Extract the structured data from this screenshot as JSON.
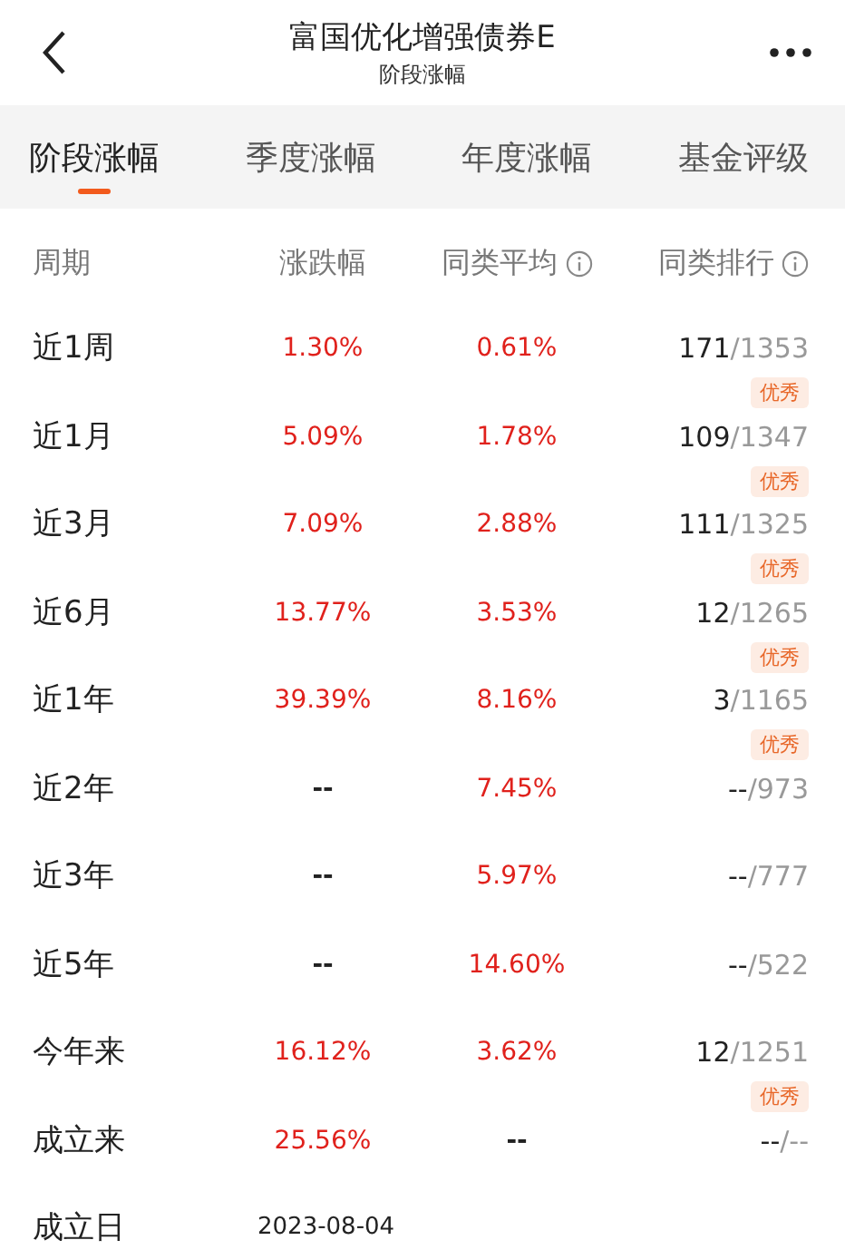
{
  "header": {
    "title": "富国优化增强债券E",
    "subtitle": "阶段涨幅"
  },
  "tabs": [
    {
      "label": "阶段涨幅",
      "selected": true
    },
    {
      "label": "季度涨幅",
      "selected": false
    },
    {
      "label": "年度涨幅",
      "selected": false
    },
    {
      "label": "基金评级",
      "selected": false
    }
  ],
  "table": {
    "columns": [
      {
        "label": "周期",
        "info": false
      },
      {
        "label": "涨跌幅",
        "info": false
      },
      {
        "label": "同类平均",
        "info": true
      },
      {
        "label": "同类排行",
        "info": true
      }
    ],
    "rows": [
      {
        "period": "近1周",
        "change": {
          "text": "1.30%",
          "rising": true
        },
        "average": {
          "text": "0.61%",
          "rising": true
        },
        "rank": "171",
        "total": "/1353",
        "badge": "优秀"
      },
      {
        "period": "近1月",
        "change": {
          "text": "5.09%",
          "rising": true
        },
        "average": {
          "text": "1.78%",
          "rising": true
        },
        "rank": "109",
        "total": "/1347",
        "badge": "优秀"
      },
      {
        "period": "近3月",
        "change": {
          "text": "7.09%",
          "rising": true
        },
        "average": {
          "text": "2.88%",
          "rising": true
        },
        "rank": "111",
        "total": "/1325",
        "badge": "优秀"
      },
      {
        "period": "近6月",
        "change": {
          "text": "13.77%",
          "rising": true
        },
        "average": {
          "text": "3.53%",
          "rising": true
        },
        "rank": "12",
        "total": "/1265",
        "badge": "优秀"
      },
      {
        "period": "近1年",
        "change": {
          "text": "39.39%",
          "rising": true
        },
        "average": {
          "text": "8.16%",
          "rising": true
        },
        "rank": "3",
        "total": "/1165",
        "badge": "优秀"
      },
      {
        "period": "近2年",
        "change": {
          "text": "--",
          "rising": false
        },
        "average": {
          "text": "7.45%",
          "rising": true
        },
        "rank": "--",
        "total": "/973"
      },
      {
        "period": "近3年",
        "change": {
          "text": "--",
          "rising": false
        },
        "average": {
          "text": "5.97%",
          "rising": true
        },
        "rank": "--",
        "total": "/777"
      },
      {
        "period": "近5年",
        "change": {
          "text": "--",
          "rising": false
        },
        "average": {
          "text": "14.60%",
          "rising": true
        },
        "rank": "--",
        "total": "/522"
      },
      {
        "period": "今年来",
        "change": {
          "text": "16.12%",
          "rising": true
        },
        "average": {
          "text": "3.62%",
          "rising": true
        },
        "rank": "12",
        "total": "/1251",
        "badge": "优秀"
      },
      {
        "period": "成立来",
        "change": {
          "text": "25.56%",
          "rising": true
        },
        "average": {
          "text": "--",
          "rising": false
        },
        "ranking": "--/--"
      }
    ],
    "inception": {
      "label": "成立日",
      "date": "2023-08-04"
    }
  }
}
